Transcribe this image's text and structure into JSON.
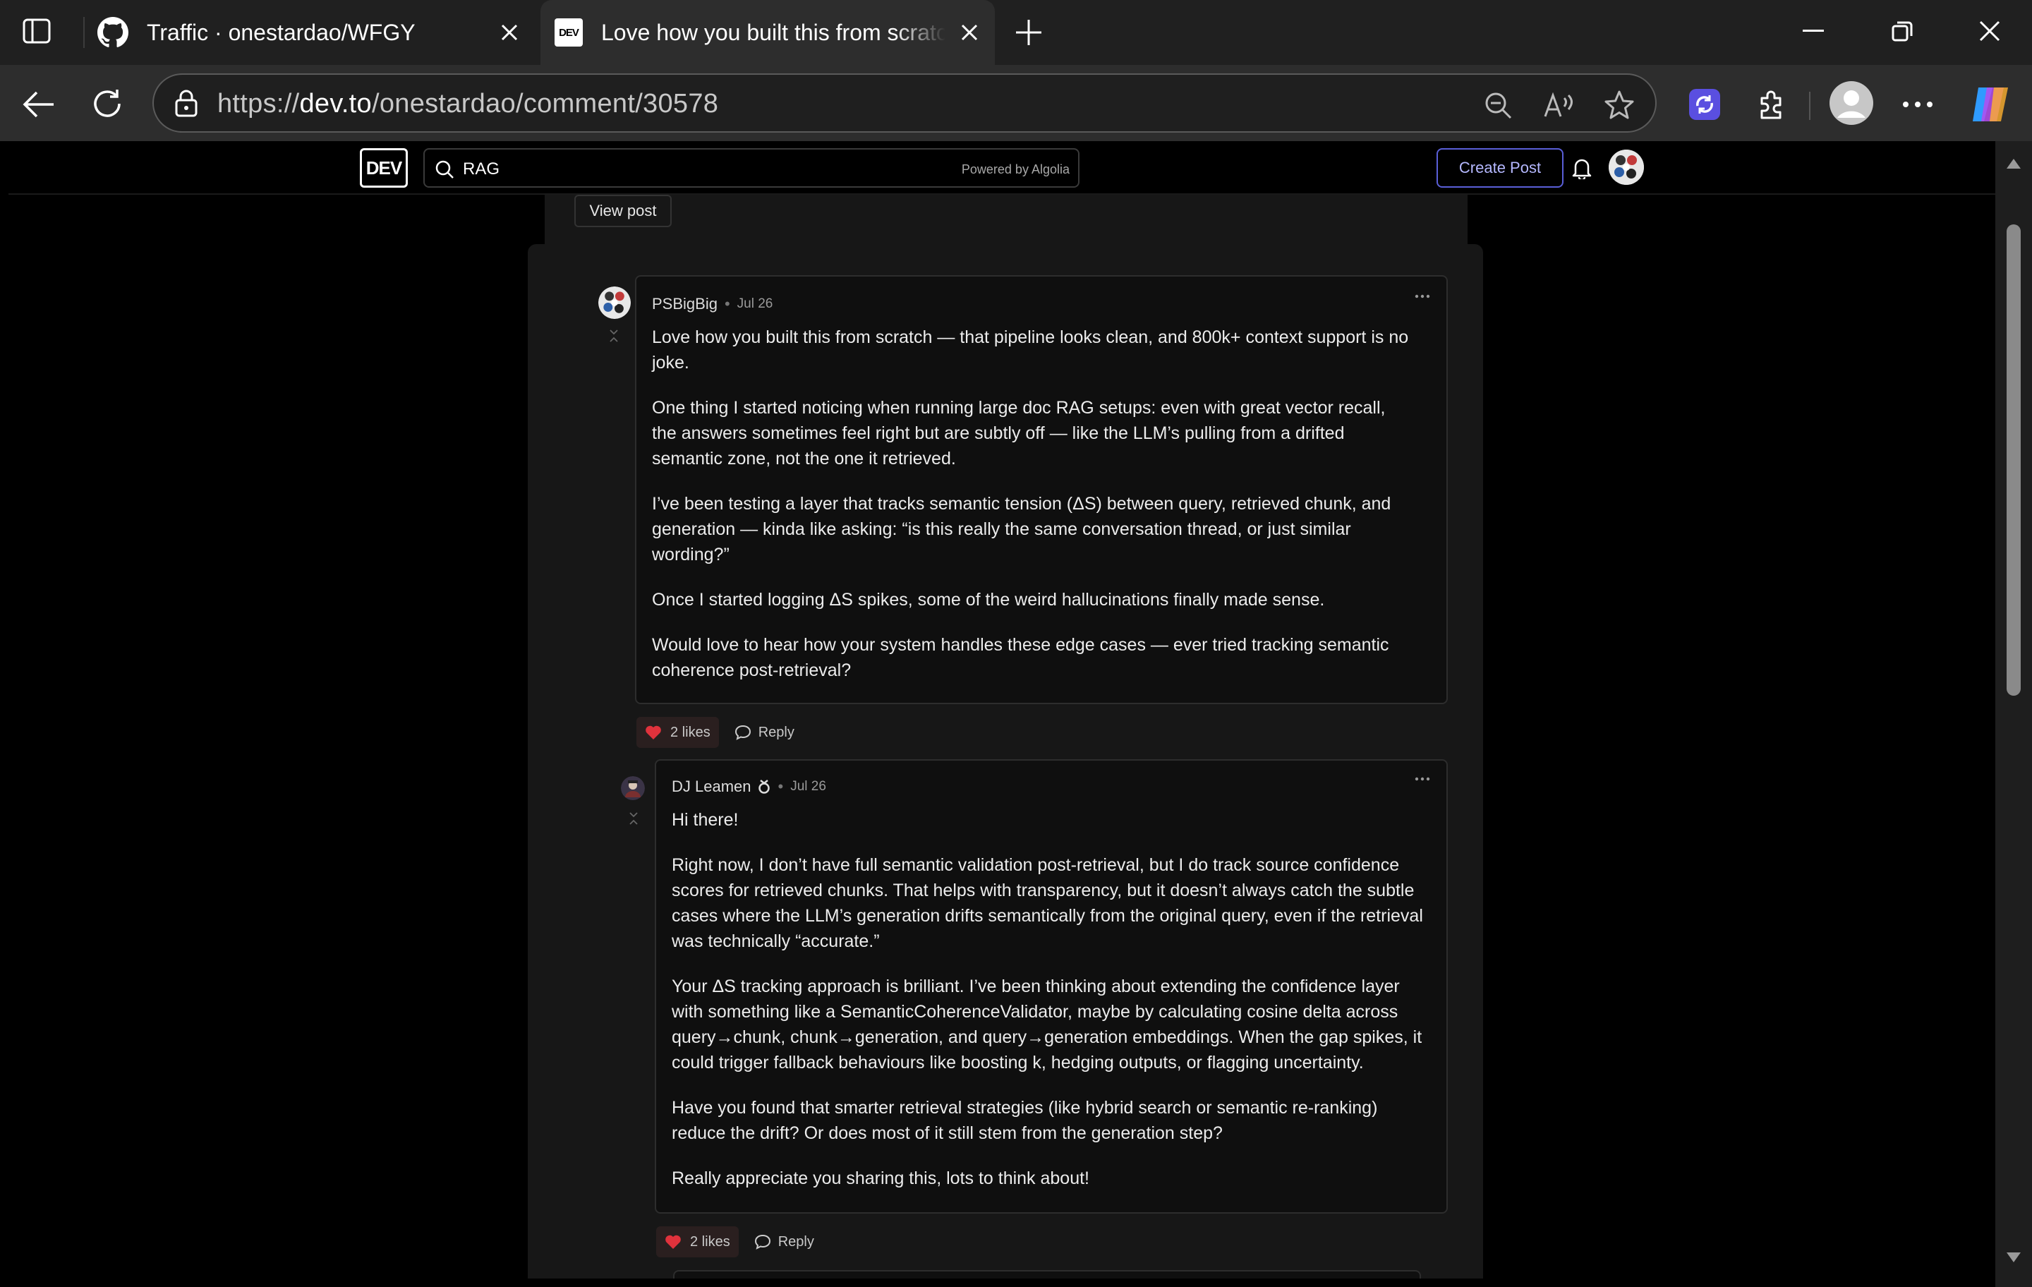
{
  "browser": {
    "tabs": [
      {
        "title": "Traffic · onestardao/WFGY",
        "favicon": "github-icon"
      },
      {
        "title": "Love how you built this from scratch",
        "favicon": "dev-icon",
        "favicon_text": "DEV"
      }
    ],
    "address": {
      "scheme": "https://",
      "host": "dev.to",
      "path": "/onestardao/comment/30578"
    }
  },
  "header": {
    "logo": "DEV",
    "search_value": "RAG",
    "search_powered": "Powered by Algolia",
    "create_post": "Create Post"
  },
  "post": {
    "view_post": "View post"
  },
  "comments": [
    {
      "author": "PSBigBig",
      "date": "Jul 26",
      "paragraphs": [
        "Love how you built this from scratch — that pipeline looks clean, and 800k+ context support is no joke.",
        "One thing I started noticing when running large doc RAG setups: even with great vector recall, the answers sometimes feel right but are subtly off — like the LLM’s pulling from a drifted semantic zone, not the one it retrieved.",
        "I’ve been testing a layer that tracks semantic tension (ΔS) between query, retrieved chunk, and generation — kinda like asking: “is this really the same conversation thread, or just similar wording?”",
        "Once I started logging ΔS spikes, some of the weird hallucinations finally made sense.",
        "Would love to hear how your system handles these edge cases — ever tried tracking semantic coherence post-retrieval?"
      ],
      "likes": "2 likes",
      "reply": "Reply"
    },
    {
      "author": "DJ Leamen",
      "date": "Jul 26",
      "paragraphs": [
        "Hi there!",
        "Right now, I don’t have full semantic validation post-retrieval, but I do track source confidence scores for retrieved chunks. That helps with transparency, but it doesn’t always catch the subtle cases where the LLM’s generation drifts semantically from the original query, even if the retrieval was technically “accurate.”",
        "Your ΔS tracking approach is brilliant. I’ve been thinking about extending the confidence layer with something like a SemanticCoherenceValidator, maybe by calculating cosine delta across query→chunk, chunk→generation, and query→generation embeddings. When the gap spikes, it could trigger fallback behaviours like boosting k, hedging outputs, or flagging uncertainty.",
        "Have you found that smarter retrieval strategies (like hybrid search or semantic re-ranking) reduce the drift? Or does most of it still stem from the generation step?",
        "Really appreciate you sharing this, lots to think about!"
      ],
      "likes": "2 likes",
      "reply": "Reply"
    }
  ],
  "colors": {
    "accent": "#5a5fd8",
    "heart": "#e0323c",
    "page_bg": "#000000",
    "card_bg": "#171717"
  }
}
